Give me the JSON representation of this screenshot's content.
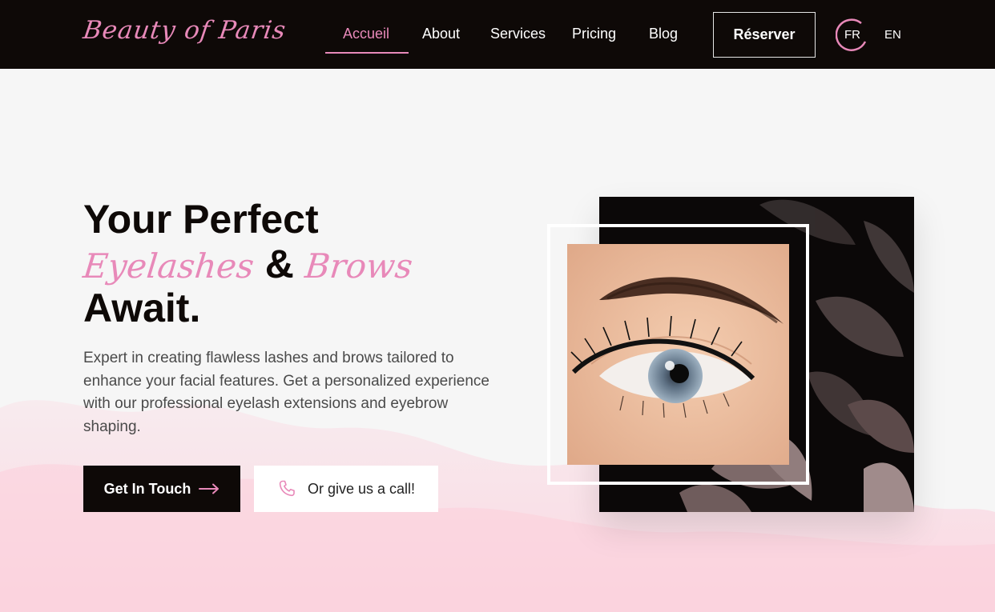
{
  "header": {
    "logo": "Beauty of Paris",
    "nav": [
      "Accueil",
      "About",
      "Services",
      "Pricing",
      "Blog"
    ],
    "active_nav": "Accueil",
    "reserve_label": "Réserver",
    "lang_fr": "FR",
    "lang_en": "EN"
  },
  "hero": {
    "title_line1": "Your Perfect",
    "title_script1": "Eyelashes",
    "title_amp": "&",
    "title_script2": "Brows",
    "title_line3": "Await.",
    "description": "Expert in creating flawless lashes and brows tailored to enhance your facial features. Get a personalized experience with our professional eyelash extensions and eyebrow shaping.",
    "cta_primary": "Get In Touch",
    "cta_secondary": "Or give us a call!"
  },
  "icons": {
    "cta_primary": "arrow-right-icon",
    "cta_secondary": "phone-icon",
    "language": "language-ring-icon"
  },
  "colors": {
    "accent": "#e889b9",
    "dark": "#0e0907",
    "background": "#f6f6f6",
    "wash": "#fbd7e1"
  }
}
